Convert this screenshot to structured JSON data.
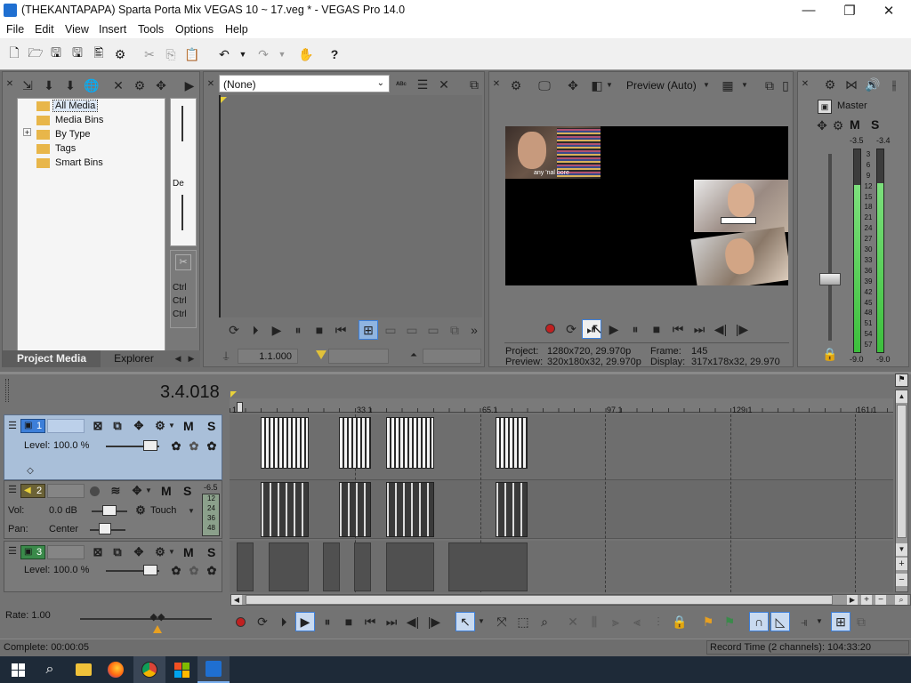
{
  "window": {
    "title": "(THEKANTAPAPA) Sparta Porta Mix VEGAS 10 ~ 17.veg * - VEGAS Pro 14.0",
    "minimize": "—",
    "maximize": "❐",
    "close": "✕"
  },
  "menu": [
    "File",
    "Edit",
    "View",
    "Insert",
    "Tools",
    "Options",
    "Help"
  ],
  "project_media": {
    "tree": [
      "All Media",
      "Media Bins",
      "By Type",
      "Tags",
      "Smart Bins"
    ],
    "expander": "+",
    "tabs": [
      "Project Media",
      "Explorer"
    ],
    "side_labels": [
      "De",
      "Ctrl",
      "Ctrl",
      "Ctrl"
    ]
  },
  "trimmer": {
    "dropdown_value": "(None)",
    "time": "1.1.000"
  },
  "preview": {
    "mode": "Preview (Auto)",
    "project_label": "Project:",
    "project_value": "1280x720, 29.970p",
    "preview_label": "Preview:",
    "preview_value": "320x180x32, 29.970p",
    "frame_label": "Frame:",
    "frame_value": "145",
    "display_label": "Display:",
    "display_value": "317x178x32, 29.970",
    "caption": "any 'nal bore"
  },
  "master": {
    "title": "Master",
    "m": "M",
    "s": "S",
    "top_left": "-3.5",
    "top_right": "-3.4",
    "bottom_left": "-9.0",
    "bottom_right": "-9.0",
    "scale": [
      "3",
      "6",
      "9",
      "12",
      "15",
      "18",
      "21",
      "24",
      "27",
      "30",
      "33",
      "36",
      "39",
      "42",
      "45",
      "48",
      "51",
      "54",
      "57"
    ]
  },
  "timeline": {
    "time": "3.4.018",
    "ruler": [
      "1.1",
      "33.1",
      "65.1",
      "97.1",
      "129.1",
      "161.1"
    ],
    "rate_label": "Rate: 1.00"
  },
  "tracks": [
    {
      "number": "1",
      "m": "M",
      "s": "S",
      "level_label": "Level:",
      "level_value": "100.0 %"
    },
    {
      "number": "2",
      "m": "M",
      "s": "S",
      "db_top": "-6.5",
      "vol_label": "Vol:",
      "vol_value": "0.0 dB",
      "mode": "Touch",
      "pan_label": "Pan:",
      "pan_value": "Center",
      "meter": [
        "12",
        "24",
        "36",
        "48"
      ]
    },
    {
      "number": "3",
      "m": "M",
      "s": "S",
      "level_label": "Level:",
      "level_value": "100.0 %"
    }
  ],
  "status": {
    "complete": "Complete: 00:00:05",
    "record_time": "Record Time (2 channels): 104:33:20"
  },
  "colors": {
    "panel_bg": "#6e6e6e",
    "track_video_selected": "#a9bfd9",
    "meter_green": "#4cd04c",
    "play_highlight": "#3d7fd9"
  }
}
